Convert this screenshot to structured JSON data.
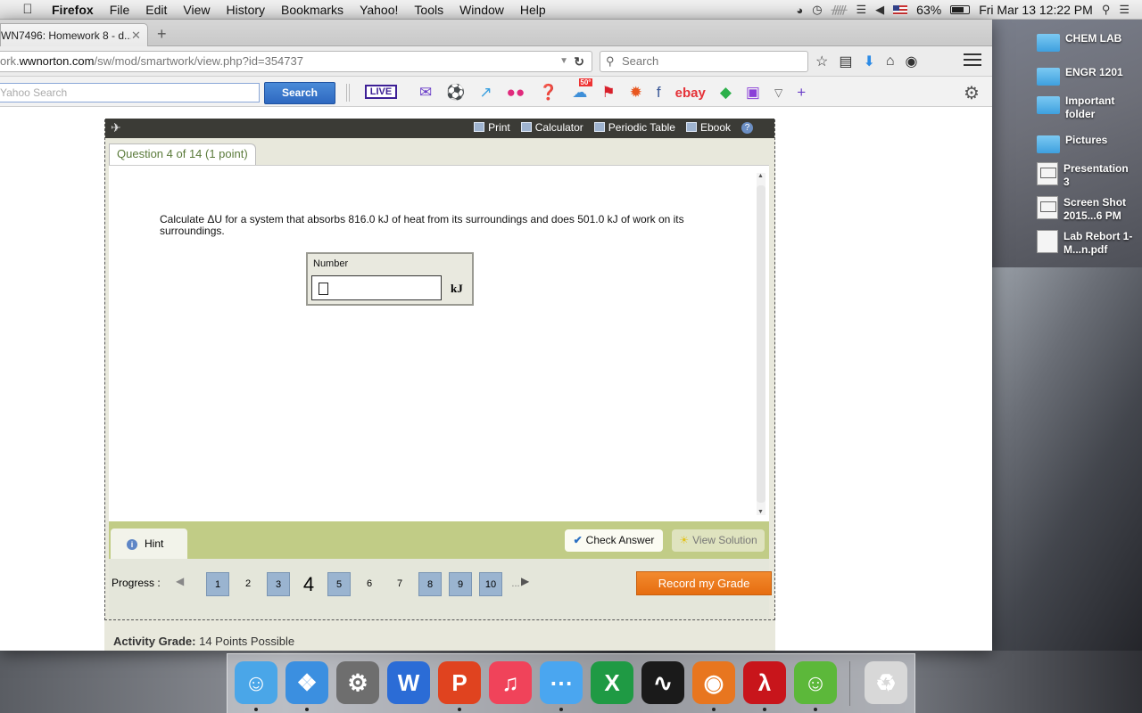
{
  "menubar": {
    "app": "Firefox",
    "items": [
      "File",
      "Edit",
      "View",
      "History",
      "Bookmarks",
      "Yahoo!",
      "Tools",
      "Window",
      "Help"
    ],
    "battery": "63%",
    "clock": "Fri Mar 13  12:22 PM"
  },
  "browser": {
    "tab_title": "WN7496: Homework 8 - d...",
    "url_prefix": "ork.",
    "url_host": "wwnorton.com",
    "url_path": "/sw/mod/smartwork/view.php?id=354737",
    "search_placeholder": "Search",
    "yahoo_search_placeholder": "Yahoo Search",
    "yahoo_search_button": "Search",
    "live_label": "LIVE",
    "weather_badge": "50°",
    "ebay_label": "ebay"
  },
  "toolbar": {
    "print": "Print",
    "calculator": "Calculator",
    "periodic_table": "Periodic Table",
    "ebook": "Ebook"
  },
  "question": {
    "tab_label": "Question 4 of 14 (1 point)",
    "text": "Calculate ΔU for a system that absorbs 816.0 kJ of heat from its surroundings and does 501.0 kJ of work on its surroundings.",
    "input_label": "Number",
    "input_value": "",
    "unit": "kJ"
  },
  "actions": {
    "hint": "Hint",
    "check_answer": "Check Answer",
    "view_solution": "View Solution"
  },
  "progress": {
    "label": "Progress :",
    "pages": [
      {
        "label": "1",
        "state": "done"
      },
      {
        "label": "2",
        "state": "todo"
      },
      {
        "label": "3",
        "state": "done"
      },
      {
        "label": "4",
        "state": "current"
      },
      {
        "label": "5",
        "state": "done"
      },
      {
        "label": "6",
        "state": "todo"
      },
      {
        "label": "7",
        "state": "todo"
      },
      {
        "label": "8",
        "state": "done"
      },
      {
        "label": "9",
        "state": "done"
      },
      {
        "label": "10",
        "state": "done"
      }
    ],
    "more": "...",
    "record_button": "Record my Grade"
  },
  "footer": {
    "activity_label": "Activity Grade:",
    "activity_value": "14 Points Possible"
  },
  "desktop": {
    "icons": [
      {
        "label": "CHEM LAB",
        "kind": "folder"
      },
      {
        "label": "ENGR 1201",
        "kind": "folder"
      },
      {
        "label": "Important folder",
        "kind": "folder"
      },
      {
        "label": "Pictures",
        "kind": "folder"
      },
      {
        "label": "Presentation 3",
        "kind": "presentation"
      },
      {
        "label": "Screen Shot 2015...6 PM",
        "kind": "screenshot"
      },
      {
        "label": "Lab Rebort 1- M...n.pdf",
        "kind": "pdf"
      }
    ]
  },
  "dock": {
    "apps": [
      "finder-icon",
      "safari-icon",
      "system-preferences-icon",
      "word-icon",
      "powerpoint-icon",
      "itunes-icon",
      "messages-icon",
      "excel-icon",
      "activity-monitor-icon",
      "firefox-icon",
      "acrobat-icon",
      "app-icon",
      "trash-icon"
    ]
  },
  "colors": {
    "record_orange": "#e66d10",
    "green_bar": "#c1cc86",
    "progress_done": "#9ab4d0",
    "yahoo_blue": "#2e68c0"
  }
}
